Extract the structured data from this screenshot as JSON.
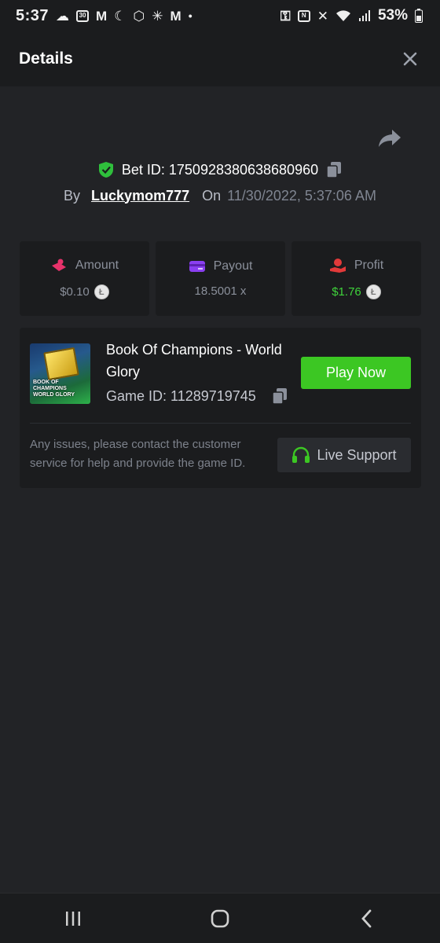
{
  "status_bar": {
    "time": "5:37",
    "battery": "53%"
  },
  "header": {
    "title": "Details"
  },
  "bet": {
    "id_label": "Bet ID: 1750928380638680960",
    "by_label": "By",
    "username": "Luckymom777",
    "on_label": "On",
    "datetime": "11/30/2022, 5:37:06 AM"
  },
  "stats": [
    {
      "label": "Amount",
      "value": "$0.10",
      "icon": "amount-icon",
      "color": "#e8336b"
    },
    {
      "label": "Payout",
      "value": "18.5001 x",
      "icon": "card-icon",
      "color": "#8a3ff0"
    },
    {
      "label": "Profit",
      "value": "$1.76",
      "icon": "profit-icon",
      "color": "#e23a3a"
    }
  ],
  "game": {
    "title": "Book Of Champions - World Glory",
    "game_id": "Game ID: 11289719745",
    "thumb_text_1": "BOOK OF",
    "thumb_text_2": "CHAMPIONS",
    "thumb_text_3": "WORLD GLORY",
    "play_label": "Play Now",
    "issues_text": "Any issues, please contact the customer service for help and provide the game ID.",
    "support_label": "Live Support"
  },
  "colors": {
    "accent_green": "#3cc723",
    "profit_green": "#3fd23b",
    "background": "#222326",
    "panel": "#1b1c1e"
  }
}
